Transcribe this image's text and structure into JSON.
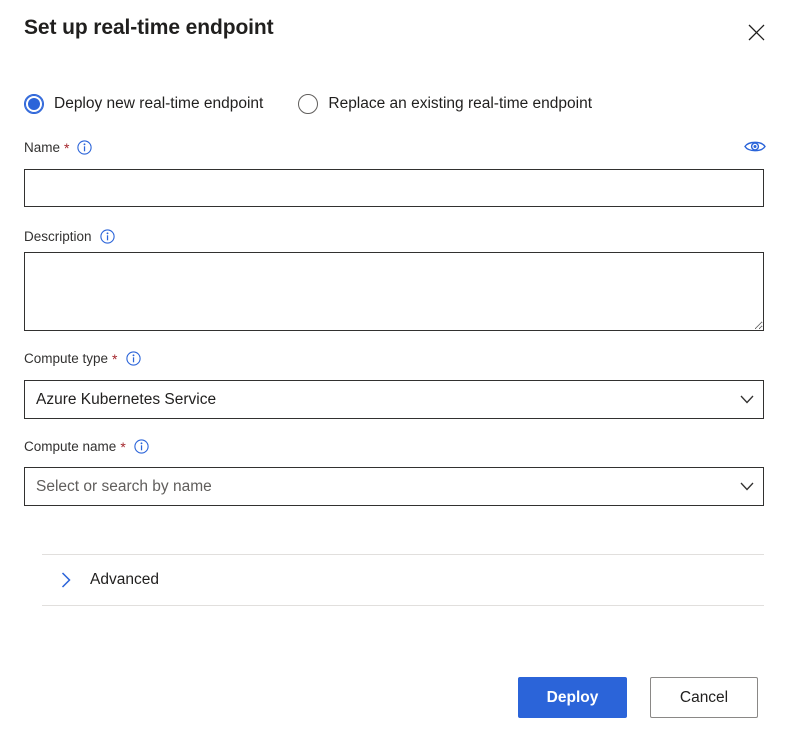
{
  "dialog": {
    "title": "Set up real-time endpoint",
    "close_label": "Close",
    "close_icon": "close-icon"
  },
  "mode_options": [
    {
      "label": "Deploy new real-time endpoint",
      "selected": true
    },
    {
      "label": "Replace an existing real-time endpoint",
      "selected": false
    }
  ],
  "fields": {
    "name": {
      "label": "Name",
      "required_marker": "*",
      "info_icon": "info-icon",
      "value": "",
      "placeholder": "",
      "reveal_icon": "eye-icon"
    },
    "description": {
      "label": "Description",
      "info_icon": "info-icon",
      "value": "",
      "placeholder": ""
    },
    "compute_type": {
      "label": "Compute type",
      "required_marker": "*",
      "info_icon": "info-icon",
      "value": "Azure Kubernetes Service",
      "caret_icon": "chevron-down-icon"
    },
    "compute_name": {
      "label": "Compute name",
      "required_marker": "*",
      "info_icon": "info-icon",
      "value": "Select or search by name",
      "caret_icon": "chevron-down-icon"
    }
  },
  "advanced": {
    "label": "Advanced",
    "expanded": false,
    "chevron_icon": "chevron-right-icon"
  },
  "footer": {
    "primary_label": "Deploy",
    "secondary_label": "Cancel"
  },
  "colors": {
    "accent": "#2b64d9",
    "required": "#a4262c",
    "text": "#201f1e",
    "muted": "#605e5c",
    "border": "#323130",
    "divider": "#e1dfdd"
  }
}
